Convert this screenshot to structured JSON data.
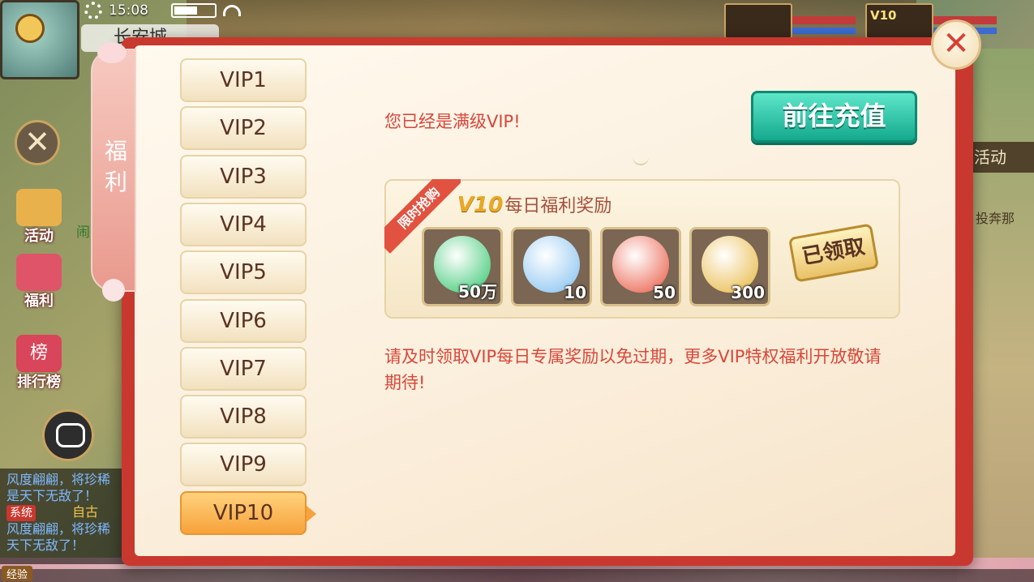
{
  "status_bar": {
    "time": "15:08",
    "battery_percent": 58
  },
  "location": {
    "city": "长安城"
  },
  "players": [
    {
      "vip": ""
    },
    {
      "vip": "V10"
    }
  ],
  "left_menu": [
    {
      "label": "活动"
    },
    {
      "label": "福利"
    },
    {
      "label": "排行榜",
      "badge": "榜"
    }
  ],
  "left_extra": {
    "partial_text": "闹天"
  },
  "chat": {
    "lines": [
      {
        "text": "风度翩翩，将珍稀"
      },
      {
        "text": "是天下无敌了！"
      },
      {
        "tag": "系统",
        "from": "自古"
      },
      {
        "text": "风度翩翩，将珍稀"
      },
      {
        "text": "天下无敌了！"
      }
    ]
  },
  "exp_label": "经验",
  "right_panel": {
    "activity": "活动",
    "quest": "投奔那"
  },
  "panel": {
    "side_tab": "福利",
    "vip_tabs": [
      "VIP1",
      "VIP2",
      "VIP3",
      "VIP4",
      "VIP5",
      "VIP6",
      "VIP7",
      "VIP8",
      "VIP9",
      "VIP10"
    ],
    "active_tab": "VIP10",
    "max_level_message": "您已经是满级VIP!",
    "recharge_button": "前往充值",
    "reward": {
      "ribbon": "限时抢购",
      "vip_badge": "V10",
      "title": "每日福利奖励",
      "items": [
        {
          "icon": "jade-ring-icon",
          "qty": "50万",
          "color": "#2fc56b"
        },
        {
          "icon": "palace-scroll-icon",
          "qty": "10",
          "color": "#7fbff0"
        },
        {
          "icon": "treasure-bag-icon",
          "qty": "50",
          "color": "#e9553f"
        },
        {
          "icon": "gold-scroll-icon",
          "qty": "300",
          "color": "#e7b43a"
        }
      ],
      "claimed_label": "已领取"
    },
    "note": "请及时领取VIP每日专属奖励以免过期，更多VIP特权福利开放敬请期待!"
  },
  "colors": {
    "panel_border": "#c9382e",
    "accent_text": "#d8473a",
    "recharge": "#14a98d"
  }
}
